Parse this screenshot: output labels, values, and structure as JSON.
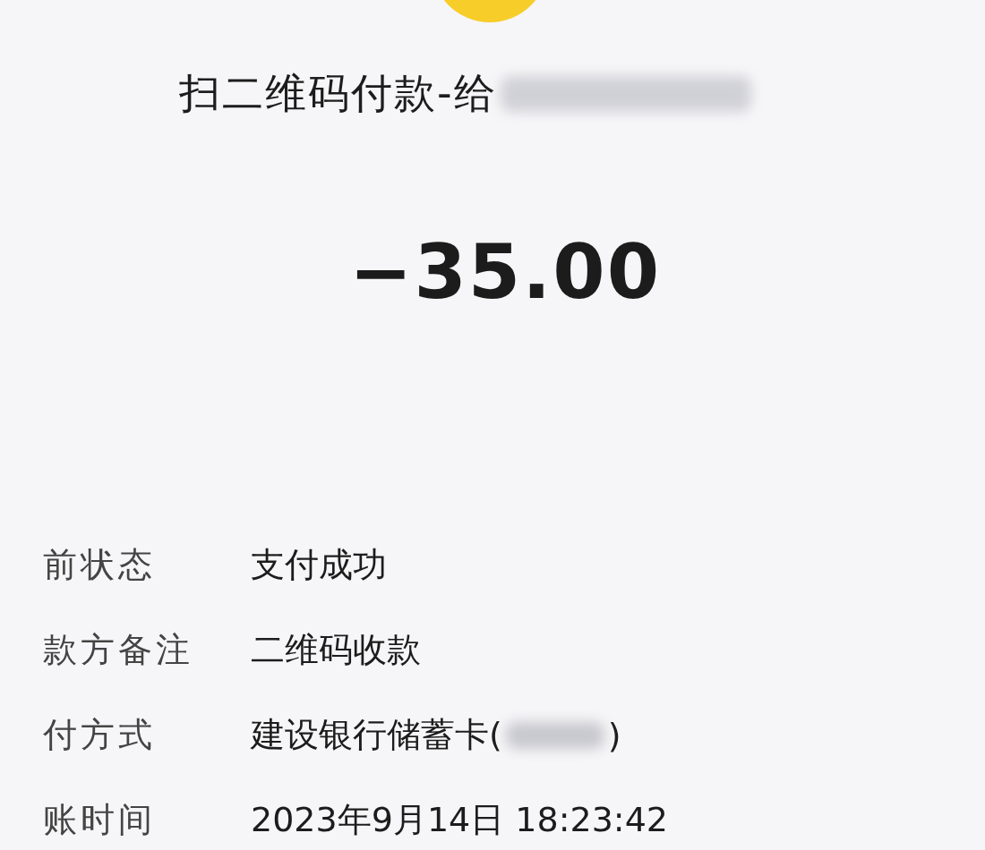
{
  "title": {
    "text": "扫二维码付款-给",
    "redacted": true
  },
  "amount": "−35.00",
  "details": [
    {
      "label": "前状态",
      "value": "支付成功",
      "redacted": false
    },
    {
      "label": "款方备注",
      "value": "二维码收款",
      "redacted": false
    },
    {
      "label": "付方式",
      "value": "建设银行储蓄卡(",
      "value_end": ")",
      "redacted": true
    },
    {
      "label": "账时间",
      "value": "2023年9月14日 18:23:42",
      "redacted": false
    }
  ]
}
